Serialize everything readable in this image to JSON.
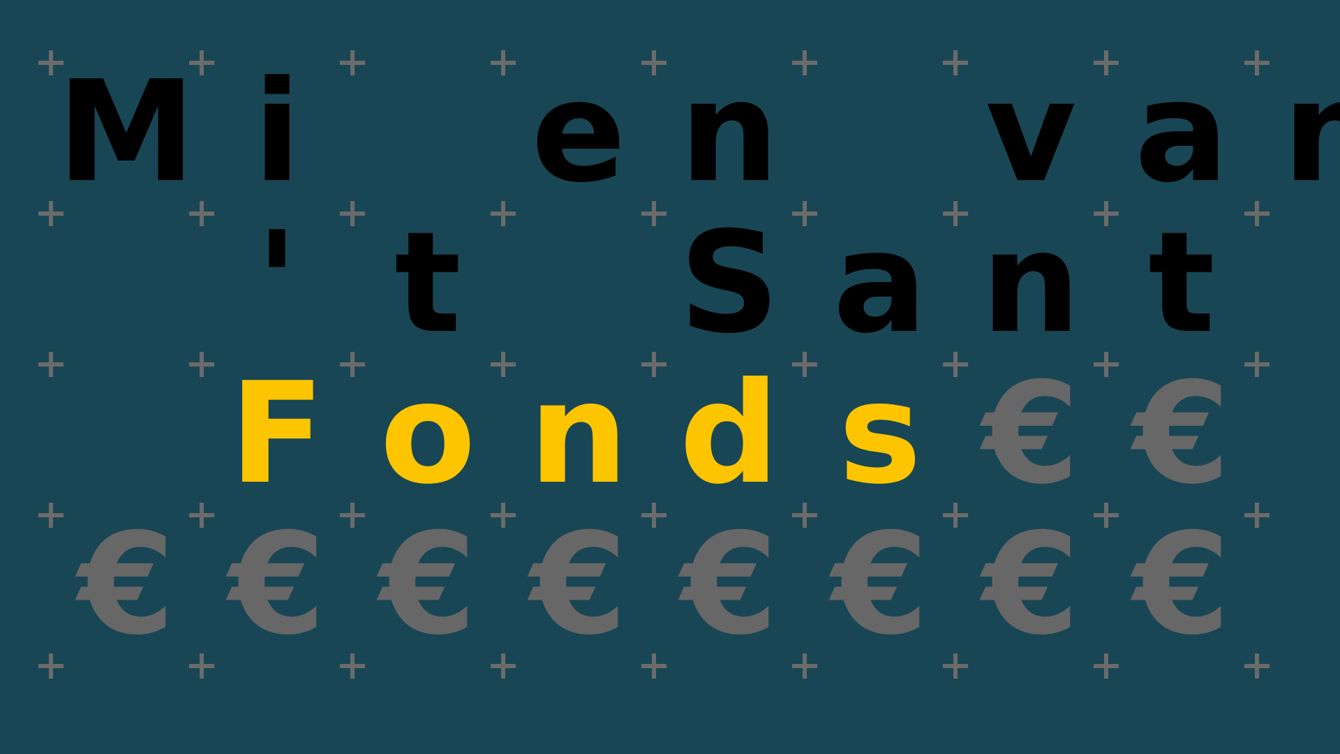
{
  "colors": {
    "background": "#194655",
    "text_primary": "#000000",
    "text_highlight": "#fdc500",
    "symbol": "#676767",
    "plus_marker": "#6b6b6b"
  },
  "rows": [
    {
      "chars": [
        "M",
        "i",
        "",
        "e",
        "n",
        "",
        "v",
        "a",
        "n"
      ],
      "colors": [
        "black",
        "black",
        "black",
        "black",
        "black",
        "black",
        "black",
        "black",
        "black"
      ]
    },
    {
      "chars": [
        "",
        "'",
        "t",
        "",
        "S",
        "a",
        "n",
        "t",
        ""
      ],
      "colors": [
        "black",
        "black",
        "black",
        "black",
        "black",
        "black",
        "black",
        "black",
        "black"
      ]
    },
    {
      "chars": [
        "",
        "F",
        "o",
        "n",
        "d",
        "s",
        "€",
        "€",
        ""
      ],
      "colors": [
        "black",
        "yellow",
        "yellow",
        "yellow",
        "yellow",
        "yellow",
        "gray",
        "gray",
        "black"
      ]
    },
    {
      "chars": [
        "€",
        "€",
        "€",
        "€",
        "€",
        "€",
        "€",
        "€",
        ""
      ],
      "colors": [
        "gray",
        "gray",
        "gray",
        "gray",
        "gray",
        "gray",
        "gray",
        "gray",
        "gray"
      ]
    }
  ],
  "grid_marker": "plus-icon"
}
